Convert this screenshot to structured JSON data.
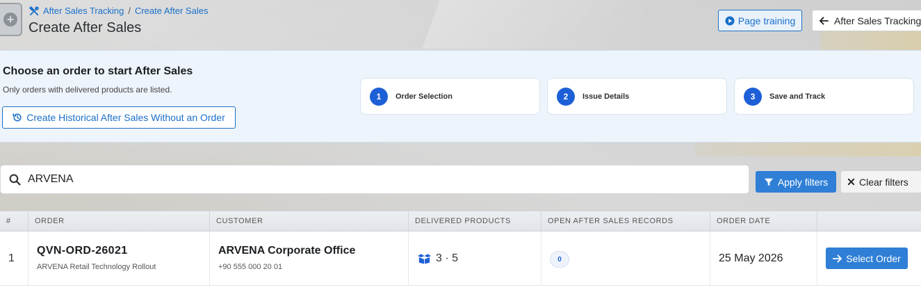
{
  "header": {
    "breadcrumb": [
      "After Sales Tracking",
      "Create After Sales"
    ],
    "breadcrumb_separator": "/",
    "title": "Create After Sales",
    "page_training_label": "Page training",
    "back_label": "After Sales Tracking"
  },
  "intro": {
    "title": "Choose an order to start After Sales",
    "subtitle": "Only orders with delivered products are listed.",
    "historical_button_label": "Create Historical After Sales Without an Order",
    "steps": [
      {
        "number": "1",
        "label": "Order Selection"
      },
      {
        "number": "2",
        "label": "Issue Details"
      },
      {
        "number": "3",
        "label": "Save and Track"
      }
    ]
  },
  "filters": {
    "search_value": "ARVENA",
    "apply_label": "Apply filters",
    "clear_label": "Clear filters"
  },
  "table": {
    "columns": [
      "#",
      "ORDER",
      "CUSTOMER",
      "DELIVERED PRODUCTS",
      "OPEN AFTER SALES RECORDS",
      "ORDER DATE",
      ""
    ],
    "rows": [
      {
        "index": "1",
        "order_id": "QVN-ORD-26021",
        "order_desc": "ARVENA Retail Technology Rollout",
        "customer": "ARVENA Corporate Office",
        "phone": "+90 555 000 20 01",
        "delivered": "3 · 5",
        "open_records": "0",
        "order_date": "25 May 2026",
        "action_label": "Select Order"
      }
    ]
  },
  "colors": {
    "primary": "#2f7fd6",
    "link": "#1a6fc9",
    "step_badge": "#1d5fd6",
    "intro_bg": "#eef4fb"
  },
  "icons": [
    "tools-icon",
    "play-circle-icon",
    "arrow-left-icon",
    "history-icon",
    "search-icon",
    "filter-icon",
    "close-icon",
    "boxes-icon",
    "arrow-right-icon"
  ]
}
